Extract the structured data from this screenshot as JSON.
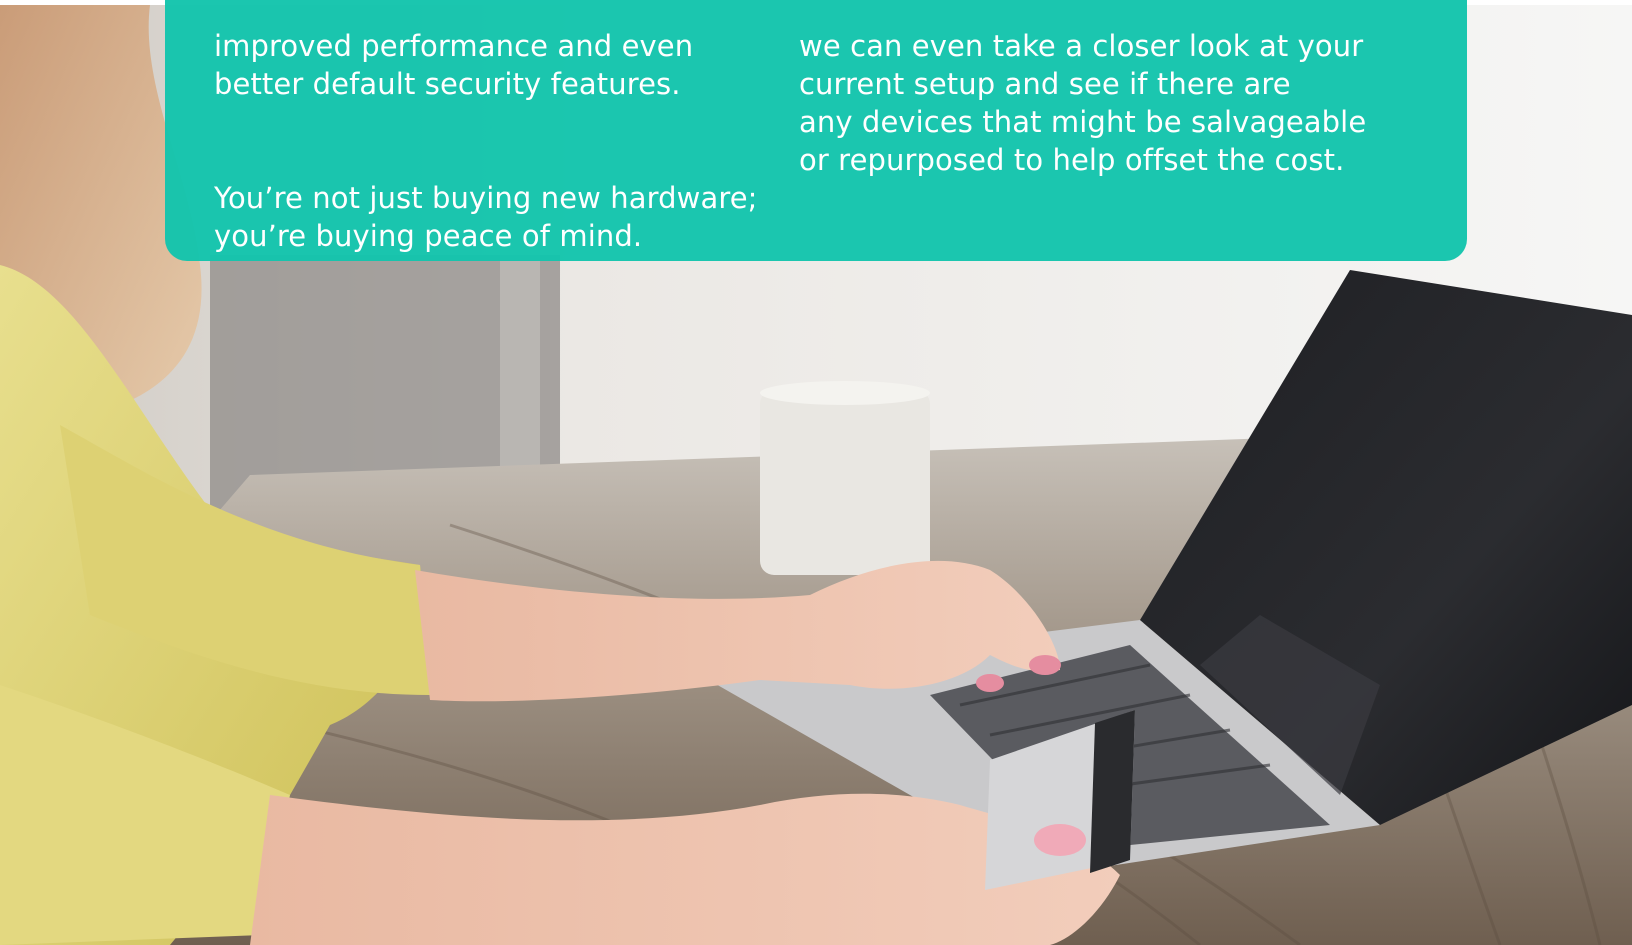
{
  "card": {
    "background_color": "#14C4AC",
    "left_column": {
      "paragraph_1": "improved performance and even\nbetter default security features.",
      "paragraph_2": "You’re not just buying new hardware;\nyou’re buying peace of mind."
    },
    "right_column": {
      "paragraph_1": "we can even take a closer look at your\ncurrent setup and see if there are\nany devices that might be salvageable\nor repurposed to help offset the cost."
    }
  },
  "photo": {
    "subject": "person-shopping-online-with-credit-card-on-laptop"
  }
}
